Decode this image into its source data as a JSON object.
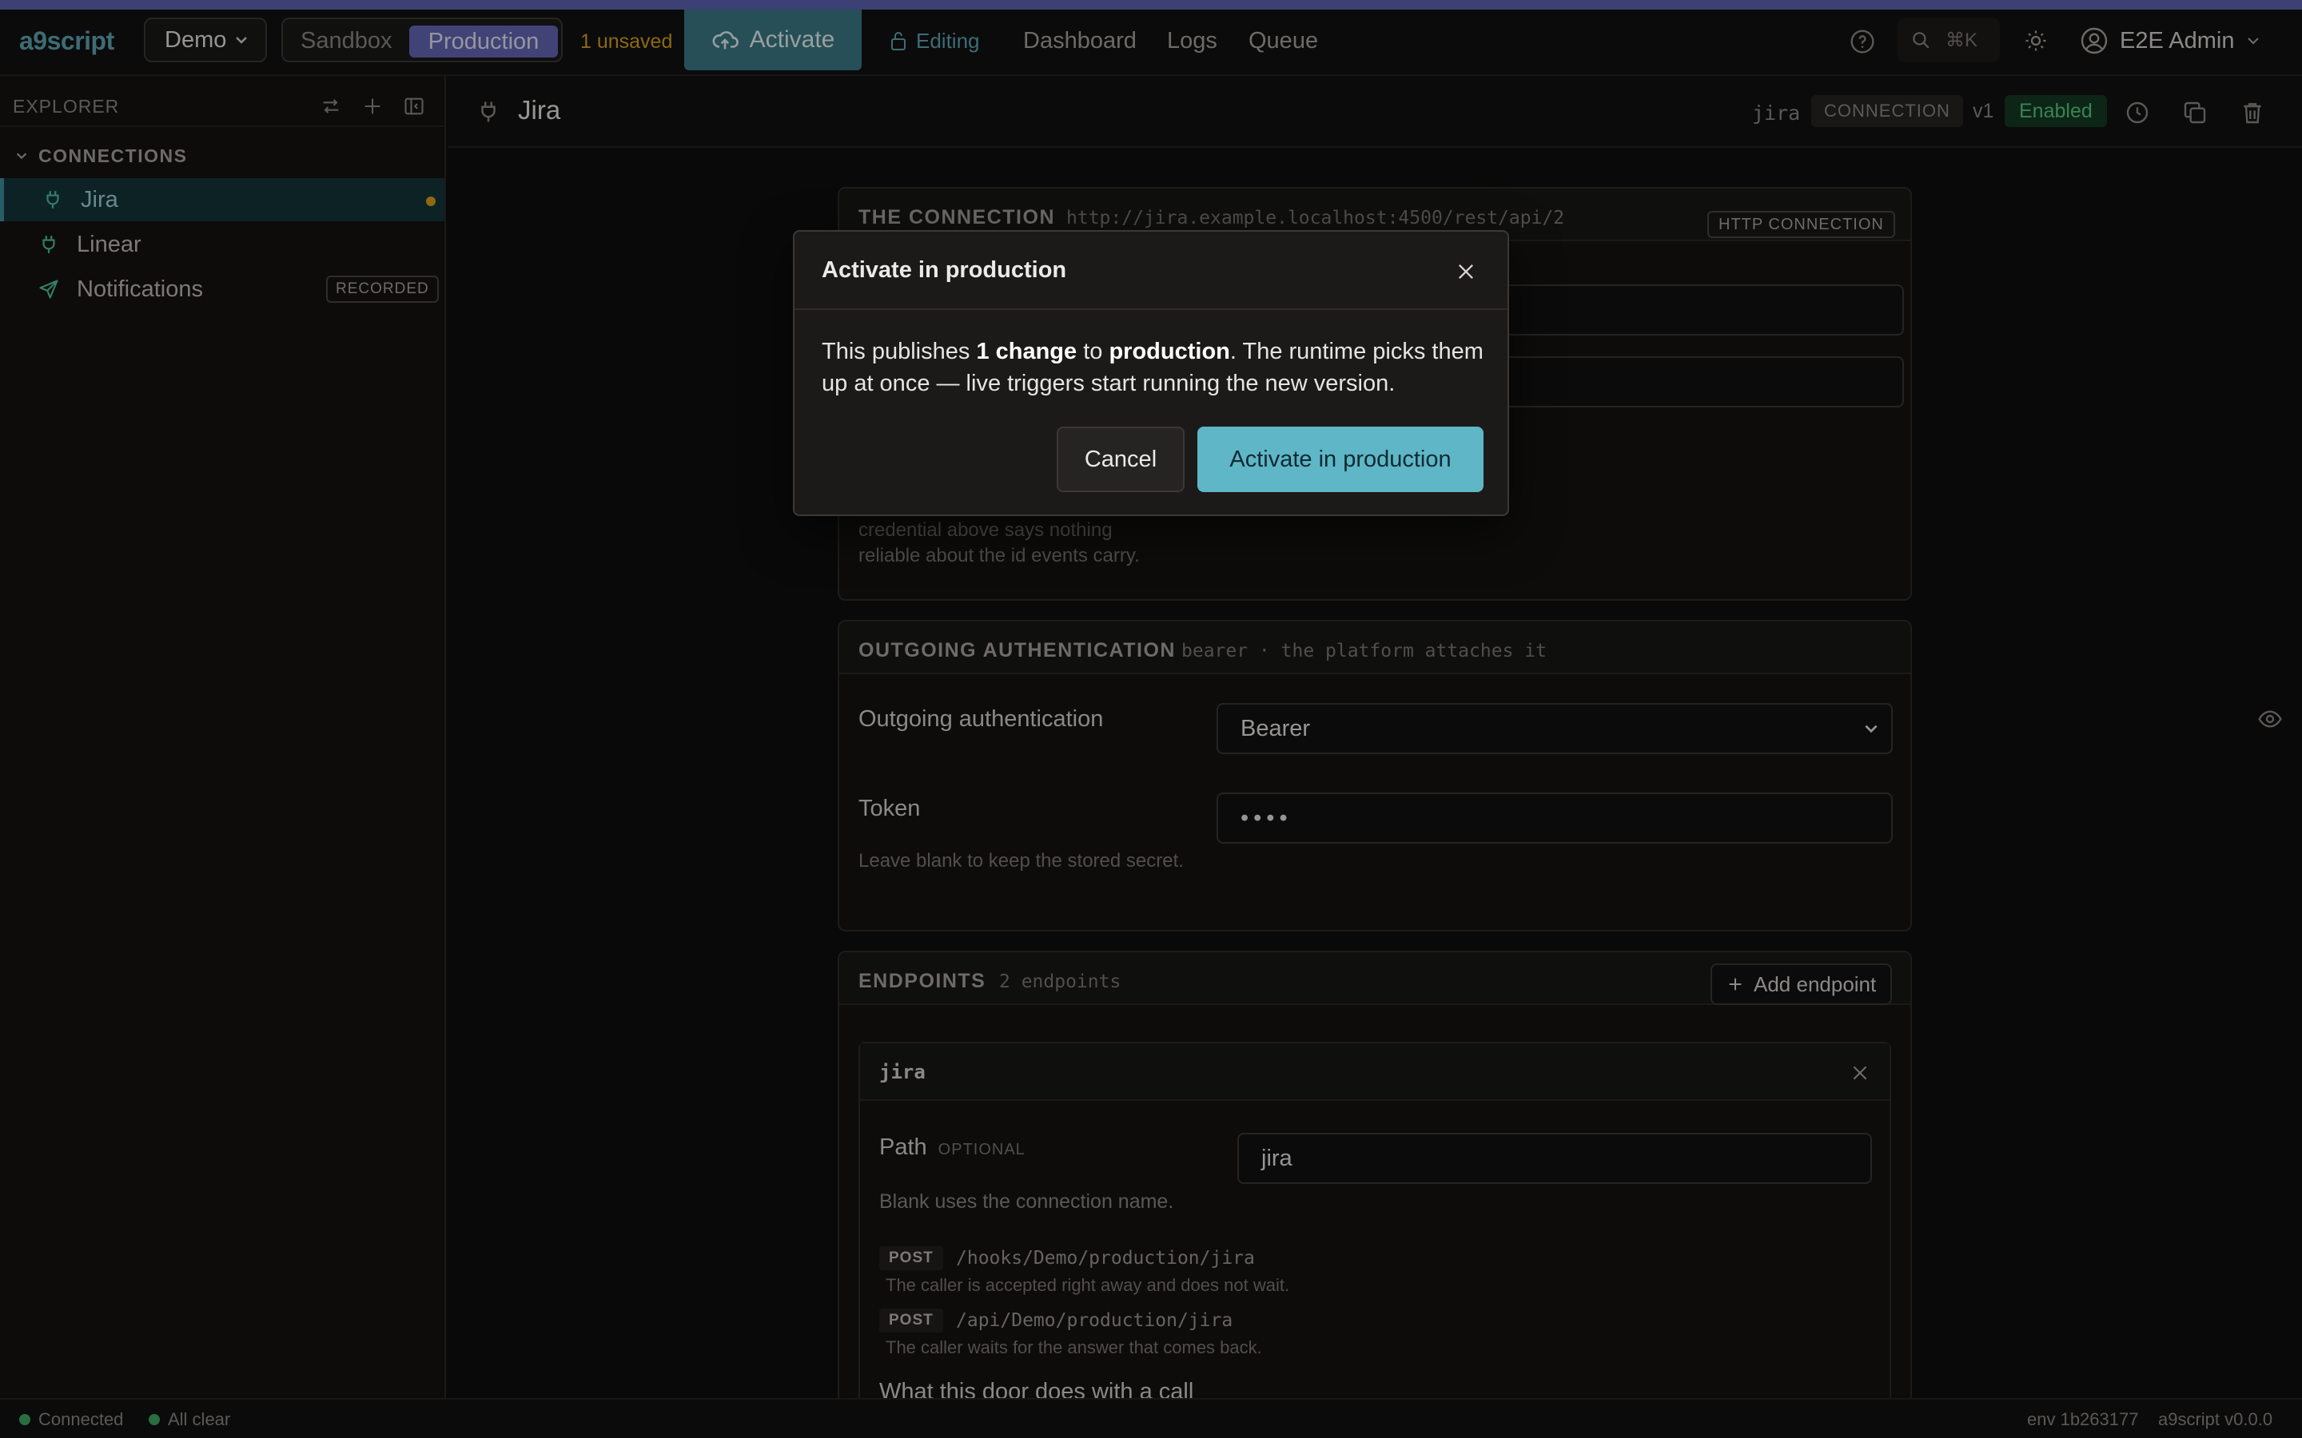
{
  "app": {
    "logo": "a9script",
    "org": "Demo",
    "env_sandbox": "Sandbox",
    "env_production": "Production",
    "unsaved": "1 unsaved",
    "activate": "Activate",
    "editing": "Editing",
    "nav": {
      "dashboard": "Dashboard",
      "logs": "Logs",
      "queue": "Queue"
    },
    "search_shortcut": "⌘K",
    "user": "E2E Admin",
    "accent_color": "#5f63b2"
  },
  "sidebar": {
    "title": "EXPLORER",
    "section": "CONNECTIONS",
    "items": [
      {
        "label": "Jira",
        "icon": "plug-icon"
      },
      {
        "label": "Linear",
        "icon": "plug-icon"
      },
      {
        "label": "Notifications",
        "icon": "send-icon",
        "badge": "RECORDED"
      }
    ]
  },
  "header": {
    "title": "Jira",
    "slug": "jira",
    "kind": "CONNECTION",
    "version": "v1",
    "status": "Enabled"
  },
  "connection": {
    "title": "THE CONNECTION",
    "url": "http://jira.example.localhost:4500/rest/api/2",
    "badge": "HTTP CONNECTION",
    "base_url_visible": "st:4500/rest/api/2",
    "help_line1": "credential above says nothing",
    "help_line2": "reliable about the id events carry."
  },
  "auth": {
    "title": "OUTGOING AUTHENTICATION",
    "subtitle": "bearer · the platform attaches it",
    "label": "Outgoing authentication",
    "selected": "Bearer",
    "token_label": "Token",
    "token_value": "••••",
    "token_help": "Leave blank to keep the stored secret."
  },
  "endpoints": {
    "title": "ENDPOINTS",
    "subtitle": "2 endpoints",
    "add_label": "Add endpoint",
    "endpoint": {
      "name": "jira",
      "path_label": "Path",
      "path_optional": "OPTIONAL",
      "path_value": "jira",
      "path_help": "Blank uses the connection name.",
      "routes": [
        {
          "method": "POST",
          "path": "/hooks/Demo/production/jira",
          "desc": "The caller is accepted right away and does not wait."
        },
        {
          "method": "POST",
          "path": "/api/Demo/production/jira",
          "desc": "The caller waits for the answer that comes back."
        }
      ],
      "door_heading": "What this door does with a call"
    }
  },
  "statusbar": {
    "connected": "Connected",
    "all_clear": "All clear",
    "env": "env 1b263177",
    "version": "a9script v0.0.0"
  },
  "modal": {
    "title": "Activate in production",
    "body_pre": "This publishes ",
    "body_count": "1 change",
    "body_mid": " to ",
    "body_env": "production",
    "body_post": ". The runtime picks them up at once — live triggers start running the new version.",
    "cancel": "Cancel",
    "confirm": "Activate in production"
  }
}
